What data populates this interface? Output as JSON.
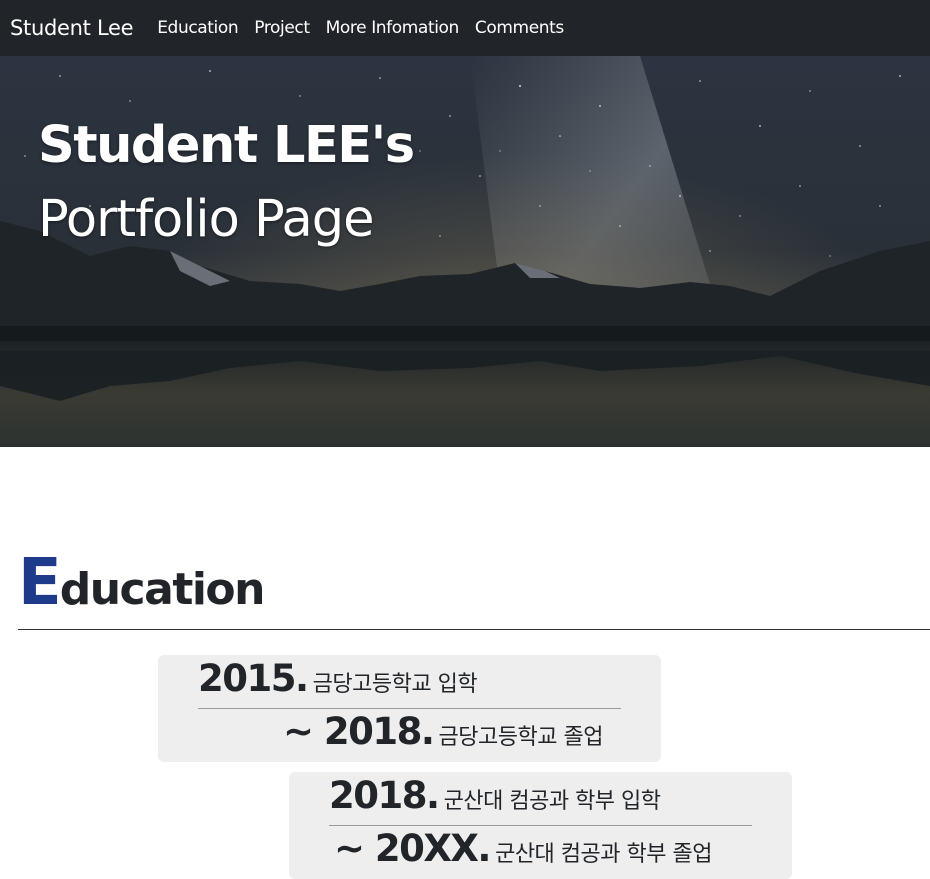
{
  "navbar": {
    "brand": "Student Lee",
    "links": [
      "Education",
      "Project",
      "More Infomation",
      "Comments"
    ]
  },
  "hero": {
    "title_line1": "Student LEE's",
    "title_line2": "Portfolio Page"
  },
  "education": {
    "heading_initial": "E",
    "heading_rest": "ducation",
    "entries": [
      {
        "start_year": "2015.",
        "start_event": "금당고등학교 입학",
        "end_year": "~ 2018.",
        "end_event": "금당고등학교 졸업"
      },
      {
        "start_year": "2018.",
        "start_event": "군산대 컴공과 학부 입학",
        "end_year": "~ 20XX.",
        "end_event": "군산대 컴공과 학부 졸업"
      }
    ]
  },
  "colors": {
    "navbar_bg": "#212529",
    "accent": "#1e3a8a",
    "card_bg": "#eeeeee"
  }
}
